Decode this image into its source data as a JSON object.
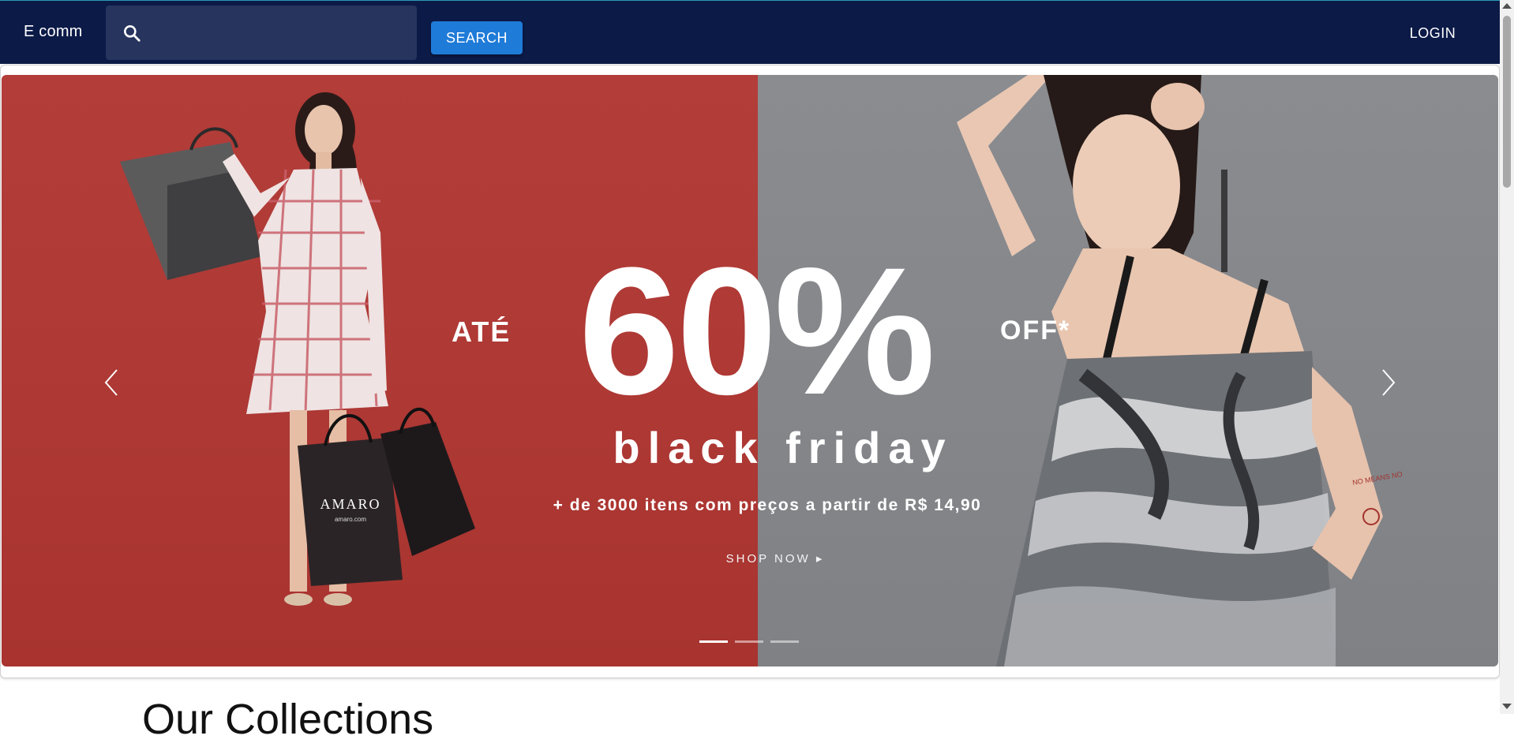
{
  "appbar": {
    "brand": "E comm",
    "search": {
      "value": "",
      "placeholder": "",
      "icon": "search-icon"
    },
    "search_button_label": "SEARCH",
    "login_label": "LOGIN"
  },
  "carousel": {
    "slide": {
      "prefix": "ATÉ",
      "discount": "60%",
      "suffix": "OFF*",
      "headline": "black friday",
      "subline": "+ de 3000 itens com preços a partir de R$ 14,90",
      "cta": "SHOP NOW ▸",
      "bag_brand": "AMARO",
      "bag_url": "amaro.com",
      "tattoo_text": "NO MEANS NO"
    },
    "indicators": [
      {
        "active": true
      },
      {
        "active": false
      },
      {
        "active": false
      }
    ],
    "prev_icon": "chevron-left-icon",
    "next_icon": "chevron-right-icon"
  },
  "section": {
    "title": "Our Collections"
  },
  "colors": {
    "appbar": "#0c1a47",
    "search_bg": "#26345e",
    "search_button": "#1f7bd8",
    "banner_red": "#b33d39",
    "banner_grey": "#8a8c90"
  }
}
